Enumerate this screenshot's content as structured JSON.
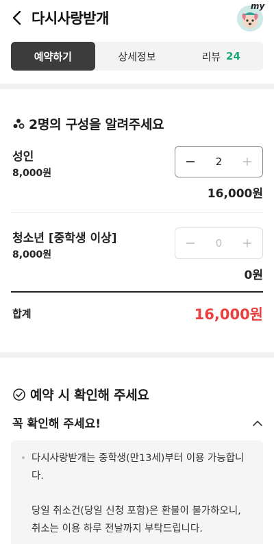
{
  "header": {
    "title": "다시사랑받개",
    "avatar_text": "my"
  },
  "tabs": [
    {
      "label": "예약하기",
      "active": true
    },
    {
      "label": "상세정보",
      "active": false
    },
    {
      "label": "리뷰",
      "count": "24",
      "active": false
    }
  ],
  "composition": {
    "title": "2명의 구성을 알려주세요",
    "rows": [
      {
        "label": "성인",
        "price": "8,000원",
        "quantity": "2",
        "total": "16,000원",
        "enabled": true
      },
      {
        "label": "청소년 [중학생 이상]",
        "price": "8,000원",
        "quantity": "0",
        "total": "0원",
        "enabled": false
      }
    ],
    "sum_label": "합계",
    "sum_value": "16,000원"
  },
  "notice": {
    "title": "예약 시 확인해 주세요",
    "subtitle": "꼭 확인해 주세요!",
    "lines": [
      "다시사랑받개는 중학생(만13세)부터 이용 가능합니",
      "다.",
      "당일 취소건(당일 신청 포함)은 환불이 불가하오니,",
      "취소는 이용 하루 전날까지 부탁드립니다."
    ]
  },
  "colors": {
    "accent_green": "#1aa877",
    "total_red": "#e8413e",
    "active_tab": "#3c3c3c"
  }
}
